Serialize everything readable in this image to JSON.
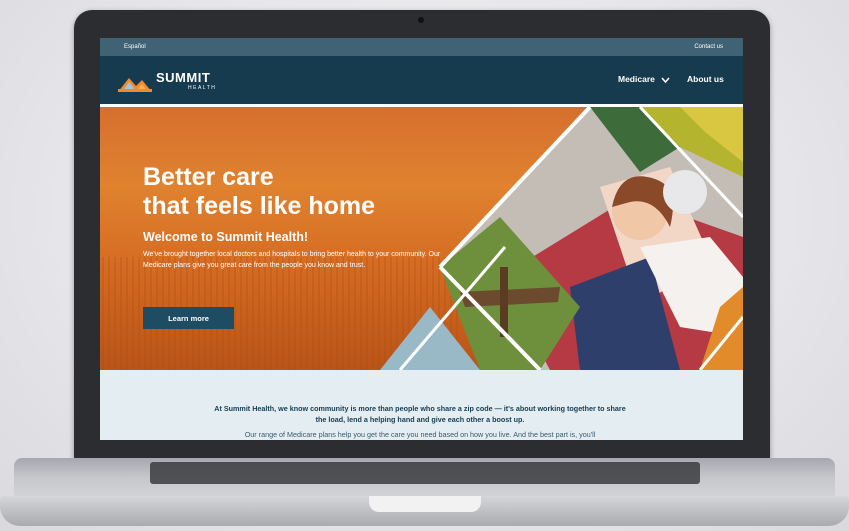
{
  "utility_bar": {
    "language_link": "Español",
    "contact_link": "Contact us"
  },
  "logo": {
    "name": "SUMMIT",
    "sub": "HEALTH"
  },
  "nav": {
    "medicare": "Medicare",
    "about": "About us"
  },
  "hero": {
    "title_line1": "Better care",
    "title_line2": "that feels like home",
    "welcome": "Welcome to Summit Health!",
    "body": "We've brought together local doctors and hospitals to bring better health to your community. Our Medicare plans give you great care from the people you know and trust.",
    "button": "Learn more"
  },
  "intro": {
    "text": "At Summit Health, we know community is more than people who share a zip code — it's about working together to share the load, lend a helping hand and give each other a boost up.",
    "text2": "Our range of Medicare plans help you get the care you need based on how you live. And the best part is, you'll"
  },
  "colors": {
    "nav_bg": "#163b4f",
    "utility_bg": "#3f6375",
    "hero_orange": "#d66f2e",
    "button_bg": "#1e4d63"
  }
}
